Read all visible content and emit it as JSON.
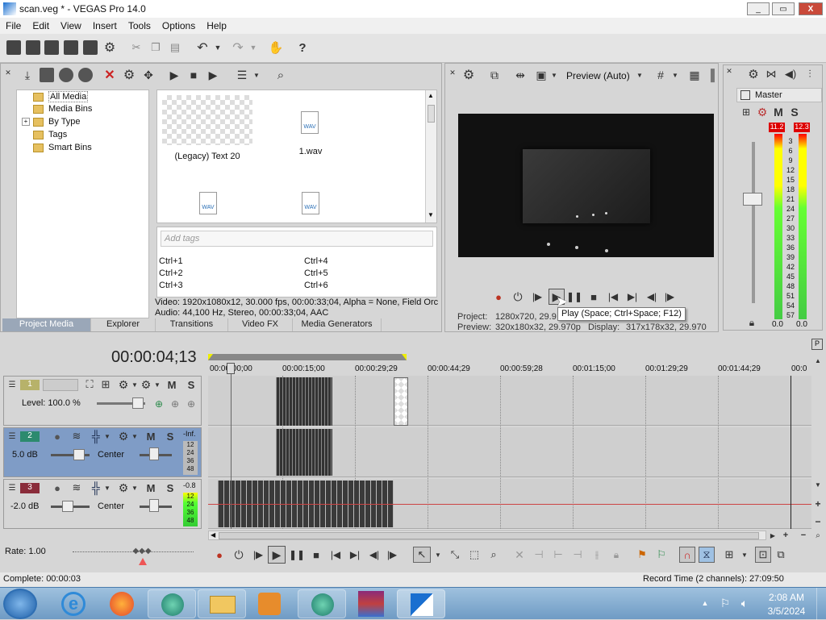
{
  "window": {
    "title": "scan.veg * - VEGAS Pro 14.0",
    "minimize": "_",
    "maximize": "▭",
    "close": "X"
  },
  "menu": [
    "File",
    "Edit",
    "View",
    "Insert",
    "Tools",
    "Options",
    "Help"
  ],
  "project_media": {
    "tree": [
      {
        "label": "All Media",
        "expander": ""
      },
      {
        "label": "Media Bins",
        "expander": ""
      },
      {
        "label": "By Type",
        "expander": "+"
      },
      {
        "label": "Tags",
        "expander": ""
      },
      {
        "label": "Smart Bins",
        "expander": ""
      }
    ],
    "items": [
      {
        "label": "(Legacy) Text 20",
        "badge": ""
      },
      {
        "label": "1.wav",
        "badge": "WAV"
      },
      {
        "label": "",
        "badge": "WAV"
      },
      {
        "label": "",
        "badge": "WAV"
      }
    ],
    "tags_placeholder": "Add tags",
    "shortcuts": [
      "Ctrl+1",
      "Ctrl+2",
      "Ctrl+3",
      "Ctrl+4",
      "Ctrl+5",
      "Ctrl+6"
    ],
    "video_info": "Video: 1920x1080x12, 30.000 fps, 00:00:33;04, Alpha = None, Field Orc",
    "audio_info": "Audio: 44,100 Hz, Stereo, 00:00:33;04, AAC"
  },
  "tabs": [
    "Project Media",
    "Explorer",
    "Transitions",
    "Video FX",
    "Media Generators"
  ],
  "preview": {
    "mode": "Preview (Auto)",
    "tooltip": "Play (Space; Ctrl+Space; F12)",
    "project_label": "Project:",
    "project_value": "1280x720, 29.9",
    "preview_label": "Preview:",
    "preview_value": "320x180x32, 29.970p",
    "display_label": "Display:",
    "display_value": "317x178x32, 29.970"
  },
  "master": {
    "title": "Master",
    "mute": "M",
    "solo": "S",
    "peak_left": "11.2",
    "peak_right": "12.3",
    "scale": [
      "3",
      "6",
      "9",
      "12",
      "15",
      "18",
      "21",
      "24",
      "27",
      "30",
      "33",
      "36",
      "39",
      "42",
      "45",
      "48",
      "51",
      "54",
      "57"
    ],
    "level_left": "0.0",
    "level_right": "0.0"
  },
  "timeline": {
    "timecode": "00:00:04;13",
    "ruler": [
      "00:00:00;00",
      "00:00:15;00",
      "00:00:29;29",
      "00:00:44;29",
      "00:00:59;28",
      "00:01:15;00",
      "00:01:29;29",
      "00:01:44;29",
      "00:0"
    ],
    "tracks": [
      {
        "num": "1",
        "type": "video",
        "level": "Level: 100.0 %",
        "mute": "M",
        "solo": "S"
      },
      {
        "num": "2",
        "type": "audio",
        "vol": "5.0 dB",
        "pan": "Center",
        "mute": "M",
        "solo": "S",
        "meter_top": "-Inf.",
        "meter_scale": [
          "12",
          "24",
          "36",
          "48"
        ]
      },
      {
        "num": "3",
        "type": "audio",
        "vol": "-2.0 dB",
        "pan": "Center",
        "mute": "M",
        "solo": "S",
        "meter_top": "-0.8",
        "meter_scale": [
          "12",
          "24",
          "36",
          "48"
        ]
      }
    ],
    "rate": "Rate: 1.00"
  },
  "status": {
    "complete": "Complete: 00:00:03",
    "record_time": "Record Time (2 channels): 27:09:50"
  },
  "taskbar": {
    "time": "2:08 AM",
    "date": "3/5/2024"
  },
  "colors": {
    "accent": "#9aa7b8",
    "track_video": "#b7b26a",
    "track_audio": "#2c8a6e",
    "track_audio2": "#8a2c3a",
    "selected_track": "#7f9cc6"
  }
}
